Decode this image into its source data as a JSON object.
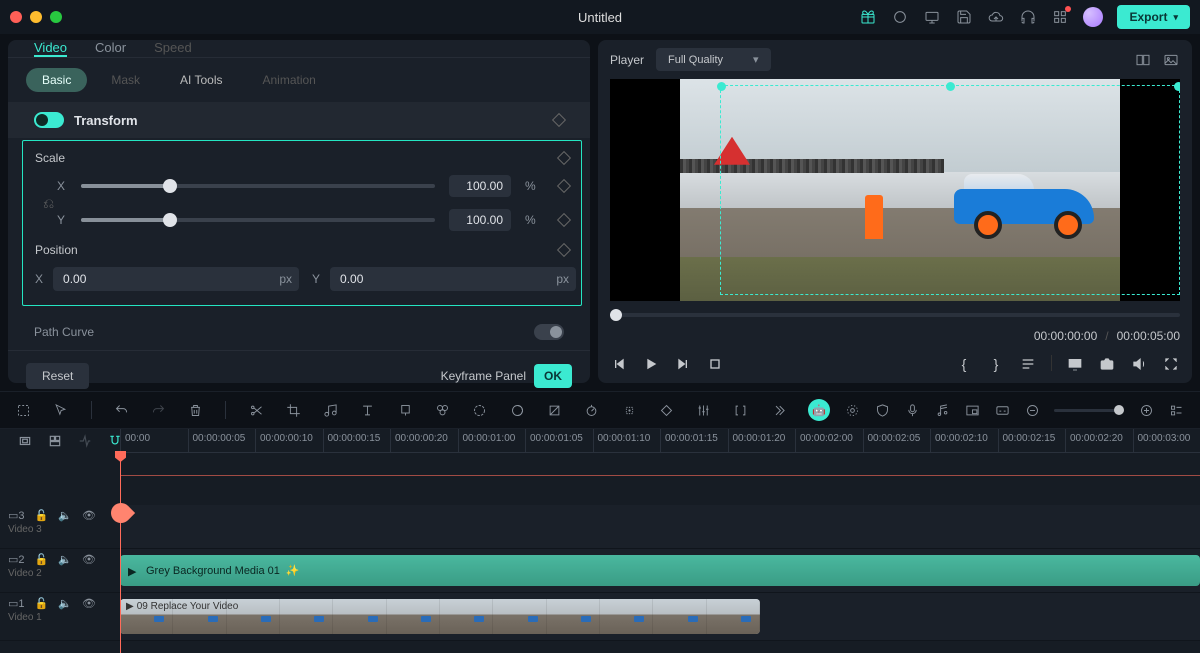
{
  "titlebar": {
    "title": "Untitled",
    "export": "Export"
  },
  "leftPanel": {
    "tabs": [
      "Video",
      "Color",
      "Speed"
    ],
    "subtabs": [
      "Basic",
      "Mask",
      "AI Tools",
      "Animation"
    ],
    "transform": "Transform",
    "scale": {
      "label": "Scale",
      "x": "X",
      "y": "Y",
      "xVal": "100.00",
      "yVal": "100.00",
      "unit": "%"
    },
    "position": {
      "label": "Position",
      "x": "X",
      "y": "Y",
      "xVal": "0.00",
      "yVal": "0.00",
      "unit": "px"
    },
    "pathCurve": "Path Curve",
    "reset": "Reset",
    "keyframePanel": "Keyframe Panel",
    "ok": "OK"
  },
  "player": {
    "label": "Player",
    "quality": "Full Quality",
    "current": "00:00:00:00",
    "total": "00:00:05:00"
  },
  "timeline": {
    "ruler": [
      "00:00",
      "00:00:00:05",
      "00:00:00:10",
      "00:00:00:15",
      "00:00:00:20",
      "00:00:01:00",
      "00:00:01:05",
      "00:00:01:10",
      "00:00:01:15",
      "00:00:01:20",
      "00:00:02:00",
      "00:00:02:05",
      "00:00:02:10",
      "00:00:02:15",
      "00:00:02:20",
      "00:00:03:00"
    ],
    "tracks": [
      {
        "idx": "3",
        "label": "Video 3"
      },
      {
        "idx": "2",
        "label": "Video 2",
        "clipName": "Grey Background Media 01"
      },
      {
        "idx": "1",
        "label": "Video 1",
        "clipName": "09 Replace Your Video"
      }
    ]
  }
}
